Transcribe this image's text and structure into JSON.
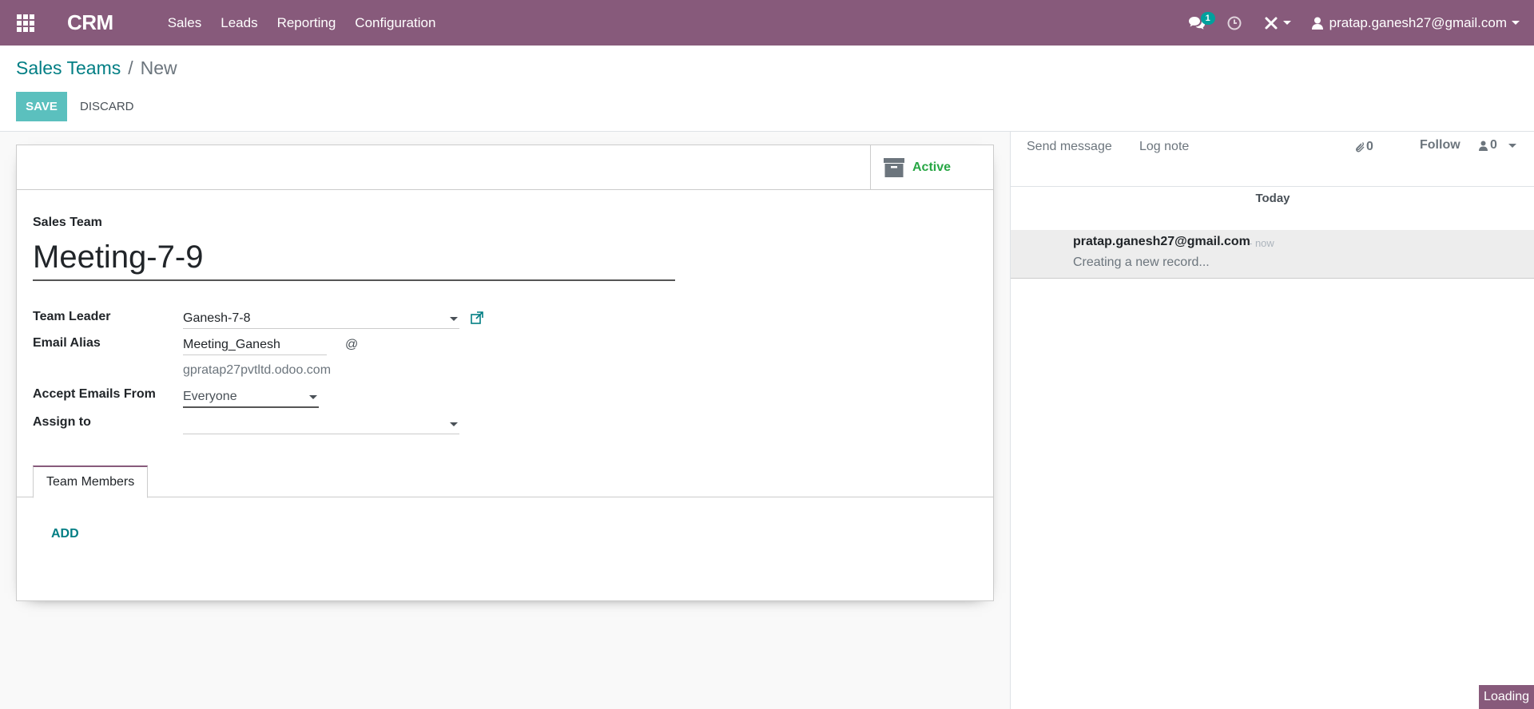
{
  "nav": {
    "brand": "CRM",
    "menu": [
      "Sales",
      "Leads",
      "Reporting",
      "Configuration"
    ],
    "messages_badge": "1",
    "user": "pratap.ganesh27@gmail.com"
  },
  "breadcrumb": {
    "parent": "Sales Teams",
    "separator": "/",
    "current": "New"
  },
  "actions": {
    "save": "SAVE",
    "discard": "DISCARD"
  },
  "form": {
    "active_label": "Active",
    "title_label": "Sales Team",
    "title_value": "Meeting-7-9",
    "fields": {
      "team_leader_label": "Team Leader",
      "team_leader_value": "Ganesh-7-8",
      "email_alias_label": "Email Alias",
      "email_alias_value": "Meeting_Ganesh",
      "email_at": "@",
      "email_domain": "gpratap27pvtltd.odoo.com",
      "accept_label": "Accept Emails From",
      "accept_value": "Everyone",
      "assign_label": "Assign to",
      "assign_value": ""
    },
    "tab_members": "Team Members",
    "add_link": "ADD"
  },
  "chatter": {
    "send_message": "Send message",
    "log_note": "Log note",
    "attachments_count": "0",
    "follow": "Follow",
    "followers_count": "0",
    "today": "Today",
    "message": {
      "author": "pratap.ganesh27@gmail.com",
      "date": "- now",
      "body": "Creating a new record..."
    }
  },
  "loading": "Loading",
  "colors": {
    "navbar": "#875a7b",
    "accent": "#017e84",
    "save_button": "#5bc0be",
    "active_green": "#28a745"
  }
}
